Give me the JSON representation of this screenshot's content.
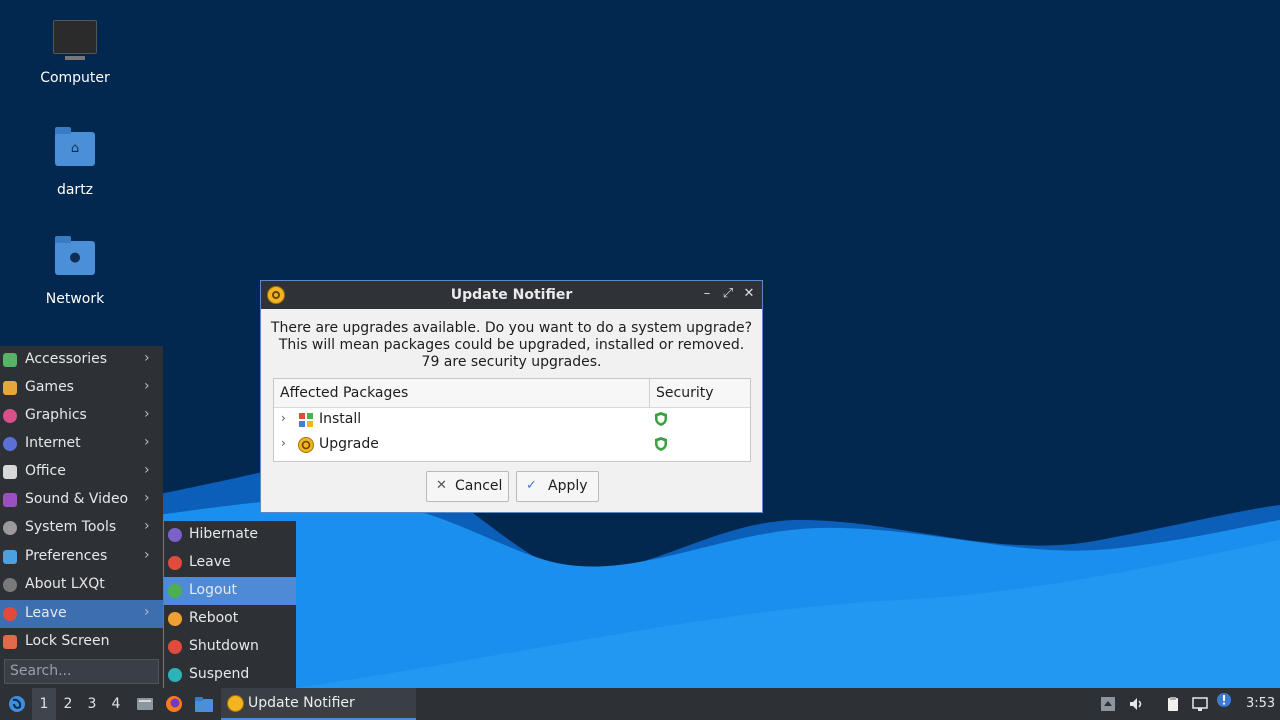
{
  "desktop": {
    "icons": [
      {
        "label": "Computer",
        "icon": "computer-icon"
      },
      {
        "label": "dartz",
        "icon": "home-folder-icon"
      },
      {
        "label": "Network",
        "icon": "network-folder-icon"
      }
    ]
  },
  "main_menu": {
    "items": [
      {
        "label": "Accessories",
        "icon": "accessories-icon",
        "has_submenu": true
      },
      {
        "label": "Games",
        "icon": "games-icon",
        "has_submenu": true
      },
      {
        "label": "Graphics",
        "icon": "graphics-icon",
        "has_submenu": true
      },
      {
        "label": "Internet",
        "icon": "internet-icon",
        "has_submenu": true
      },
      {
        "label": "Office",
        "icon": "office-icon",
        "has_submenu": true
      },
      {
        "label": "Sound & Video",
        "icon": "sound-video-icon",
        "has_submenu": true
      },
      {
        "label": "System Tools",
        "icon": "system-tools-icon",
        "has_submenu": true
      },
      {
        "label": "Preferences",
        "icon": "preferences-icon",
        "has_submenu": true
      },
      {
        "label": "About LXQt",
        "icon": "info-icon",
        "has_submenu": false
      },
      {
        "label": "Leave",
        "icon": "power-icon",
        "has_submenu": true,
        "active": true
      },
      {
        "label": "Lock Screen",
        "icon": "lock-icon",
        "has_submenu": false
      }
    ],
    "search_placeholder": "Search...",
    "submenu_arrow": "›"
  },
  "leave_submenu": {
    "items": [
      {
        "label": "Hibernate",
        "icon": "hibernate-icon"
      },
      {
        "label": "Leave",
        "icon": "power-icon"
      },
      {
        "label": "Logout",
        "icon": "logout-icon",
        "active": true
      },
      {
        "label": "Reboot",
        "icon": "reboot-icon"
      },
      {
        "label": "Shutdown",
        "icon": "shutdown-icon"
      },
      {
        "label": "Suspend",
        "icon": "suspend-icon"
      }
    ]
  },
  "dialog": {
    "title": "Update Notifier",
    "message_lines": [
      "There are upgrades available. Do you want to do a system upgrade?",
      "This will mean packages could be upgraded, installed or removed.",
      "79 are security upgrades."
    ],
    "columns": [
      "Affected Packages",
      "Security"
    ],
    "rows": [
      {
        "label": "Install",
        "icon": "install-icon",
        "security_icon": "shield-icon"
      },
      {
        "label": "Upgrade",
        "icon": "upgrade-icon",
        "security_icon": "shield-icon"
      }
    ],
    "expander": "›",
    "buttons": {
      "cancel": "Cancel",
      "apply": "Apply"
    },
    "button_icons": {
      "cancel": "✕",
      "apply": "✓"
    },
    "window_controls": {
      "minimize": "–",
      "maximize": "⤢",
      "close": "✕"
    }
  },
  "taskbar": {
    "desktops": [
      "1",
      "2",
      "3",
      "4"
    ],
    "current_desktop": "1",
    "task_label": "Update Notifier",
    "clock": "3:53"
  },
  "colors": {
    "wallpaper": "#03284f",
    "wave_light": "#1a8fee",
    "wave_dark": "#0b5fb8",
    "accent": "#4f8ad6",
    "shield": "#3aa141",
    "update_icon": "#f2b51f"
  }
}
